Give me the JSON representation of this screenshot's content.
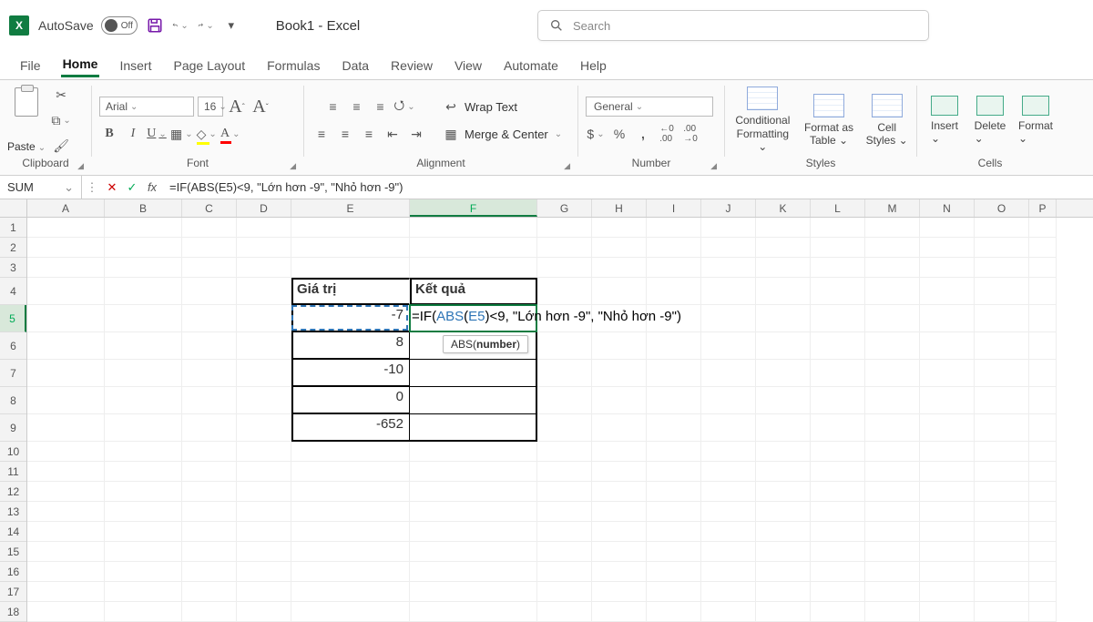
{
  "titlebar": {
    "autosave_label": "AutoSave",
    "autosave_state": "Off",
    "doc_title": "Book1 - Excel",
    "search_placeholder": "Search"
  },
  "tabs": {
    "file": "File",
    "home": "Home",
    "insert": "Insert",
    "page_layout": "Page Layout",
    "formulas": "Formulas",
    "data": "Data",
    "review": "Review",
    "view": "View",
    "automate": "Automate",
    "help": "Help"
  },
  "ribbon": {
    "paste": "Paste",
    "font_name": "Arial",
    "font_size": "16",
    "wrap_text": "Wrap Text",
    "merge_center": "Merge & Center",
    "number_format": "General",
    "cond_fmt_l1": "Conditional",
    "cond_fmt_l2": "Formatting",
    "fmt_table_l1": "Format as",
    "fmt_table_l2": "Table",
    "cell_styles_l1": "Cell",
    "cell_styles_l2": "Styles",
    "insert": "Insert",
    "delete": "Delete",
    "format": "Format",
    "g_clipboard": "Clipboard",
    "g_font": "Font",
    "g_alignment": "Alignment",
    "g_number": "Number",
    "g_styles": "Styles",
    "g_cells": "Cells"
  },
  "formula_bar": {
    "name_box": "SUM",
    "formula_text": "=IF(ABS(E5)<9, \"Lớn hơn -9\", \"Nhỏ hơn -9\")"
  },
  "columns": {
    "A": "A",
    "B": "B",
    "C": "C",
    "D": "D",
    "E": "E",
    "F": "F",
    "G": "G",
    "H": "H",
    "I": "I",
    "J": "J",
    "K": "K",
    "L": "L",
    "M": "M",
    "N": "N",
    "O": "O",
    "P": "P"
  },
  "sheet": {
    "E4": "Giá trị",
    "F4": "Kết quả",
    "E5": "-7",
    "E6": "8",
    "E7": "-10",
    "E8": "0",
    "E9": "-652",
    "F5_parts": {
      "pre": "=IF(",
      "abs": "ABS",
      "lp": "(",
      "ref": "E5",
      "rest": ")<9, \"Lớn hơn -9\", \"Nhỏ hơn -9\")"
    },
    "hint_fn": "ABS",
    "hint_arg": "number"
  }
}
